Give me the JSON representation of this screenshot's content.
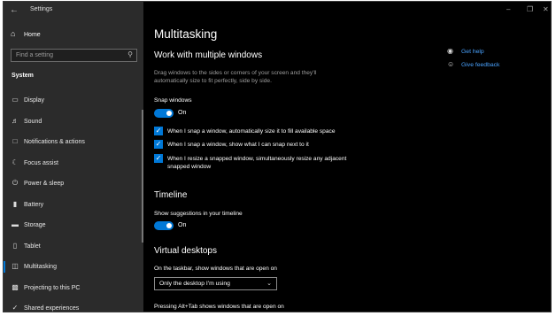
{
  "window": {
    "title": "Settings"
  },
  "sidebar": {
    "home_label": "Home",
    "search_placeholder": "Find a setting",
    "section": "System",
    "items": [
      {
        "label": "Display",
        "icon": "display-icon"
      },
      {
        "label": "Sound",
        "icon": "sound-icon"
      },
      {
        "label": "Notifications & actions",
        "icon": "notifications-icon"
      },
      {
        "label": "Focus assist",
        "icon": "focus-assist-icon"
      },
      {
        "label": "Power & sleep",
        "icon": "power-icon"
      },
      {
        "label": "Battery",
        "icon": "battery-icon"
      },
      {
        "label": "Storage",
        "icon": "storage-icon"
      },
      {
        "label": "Tablet",
        "icon": "tablet-icon"
      },
      {
        "label": "Multitasking",
        "icon": "multitasking-icon",
        "active": true
      },
      {
        "label": "Projecting to this PC",
        "icon": "projecting-icon"
      },
      {
        "label": "Shared experiences",
        "icon": "shared-experiences-icon"
      }
    ]
  },
  "main": {
    "title": "Multitasking",
    "snap": {
      "heading": "Work with multiple windows",
      "description": "Drag windows to the sides or corners of your screen and they'll automatically size to fit perfectly, side by side.",
      "toggle_label": "Snap windows",
      "toggle_state": "On",
      "checks": [
        {
          "label": "When I snap a window, automatically size it to fill available space",
          "checked": true
        },
        {
          "label": "When I snap a window, show what I can snap next to it",
          "checked": true
        },
        {
          "label": "When I resize a snapped window, simultaneously resize any adjacent snapped window",
          "checked": true
        }
      ]
    },
    "timeline": {
      "heading": "Timeline",
      "toggle_label": "Show suggestions in your timeline",
      "toggle_state": "On"
    },
    "virtual_desktops": {
      "heading": "Virtual desktops",
      "taskbar_label": "On the taskbar, show windows that are open on",
      "taskbar_value": "Only the desktop I'm using",
      "alttab_label": "Pressing Alt+Tab shows windows that are open on"
    }
  },
  "help": {
    "get_help": "Get help",
    "give_feedback": "Give feedback"
  },
  "colors": {
    "accent": "#0078d7",
    "sidebar_bg": "#2b2b2b",
    "main_bg": "#000000"
  }
}
